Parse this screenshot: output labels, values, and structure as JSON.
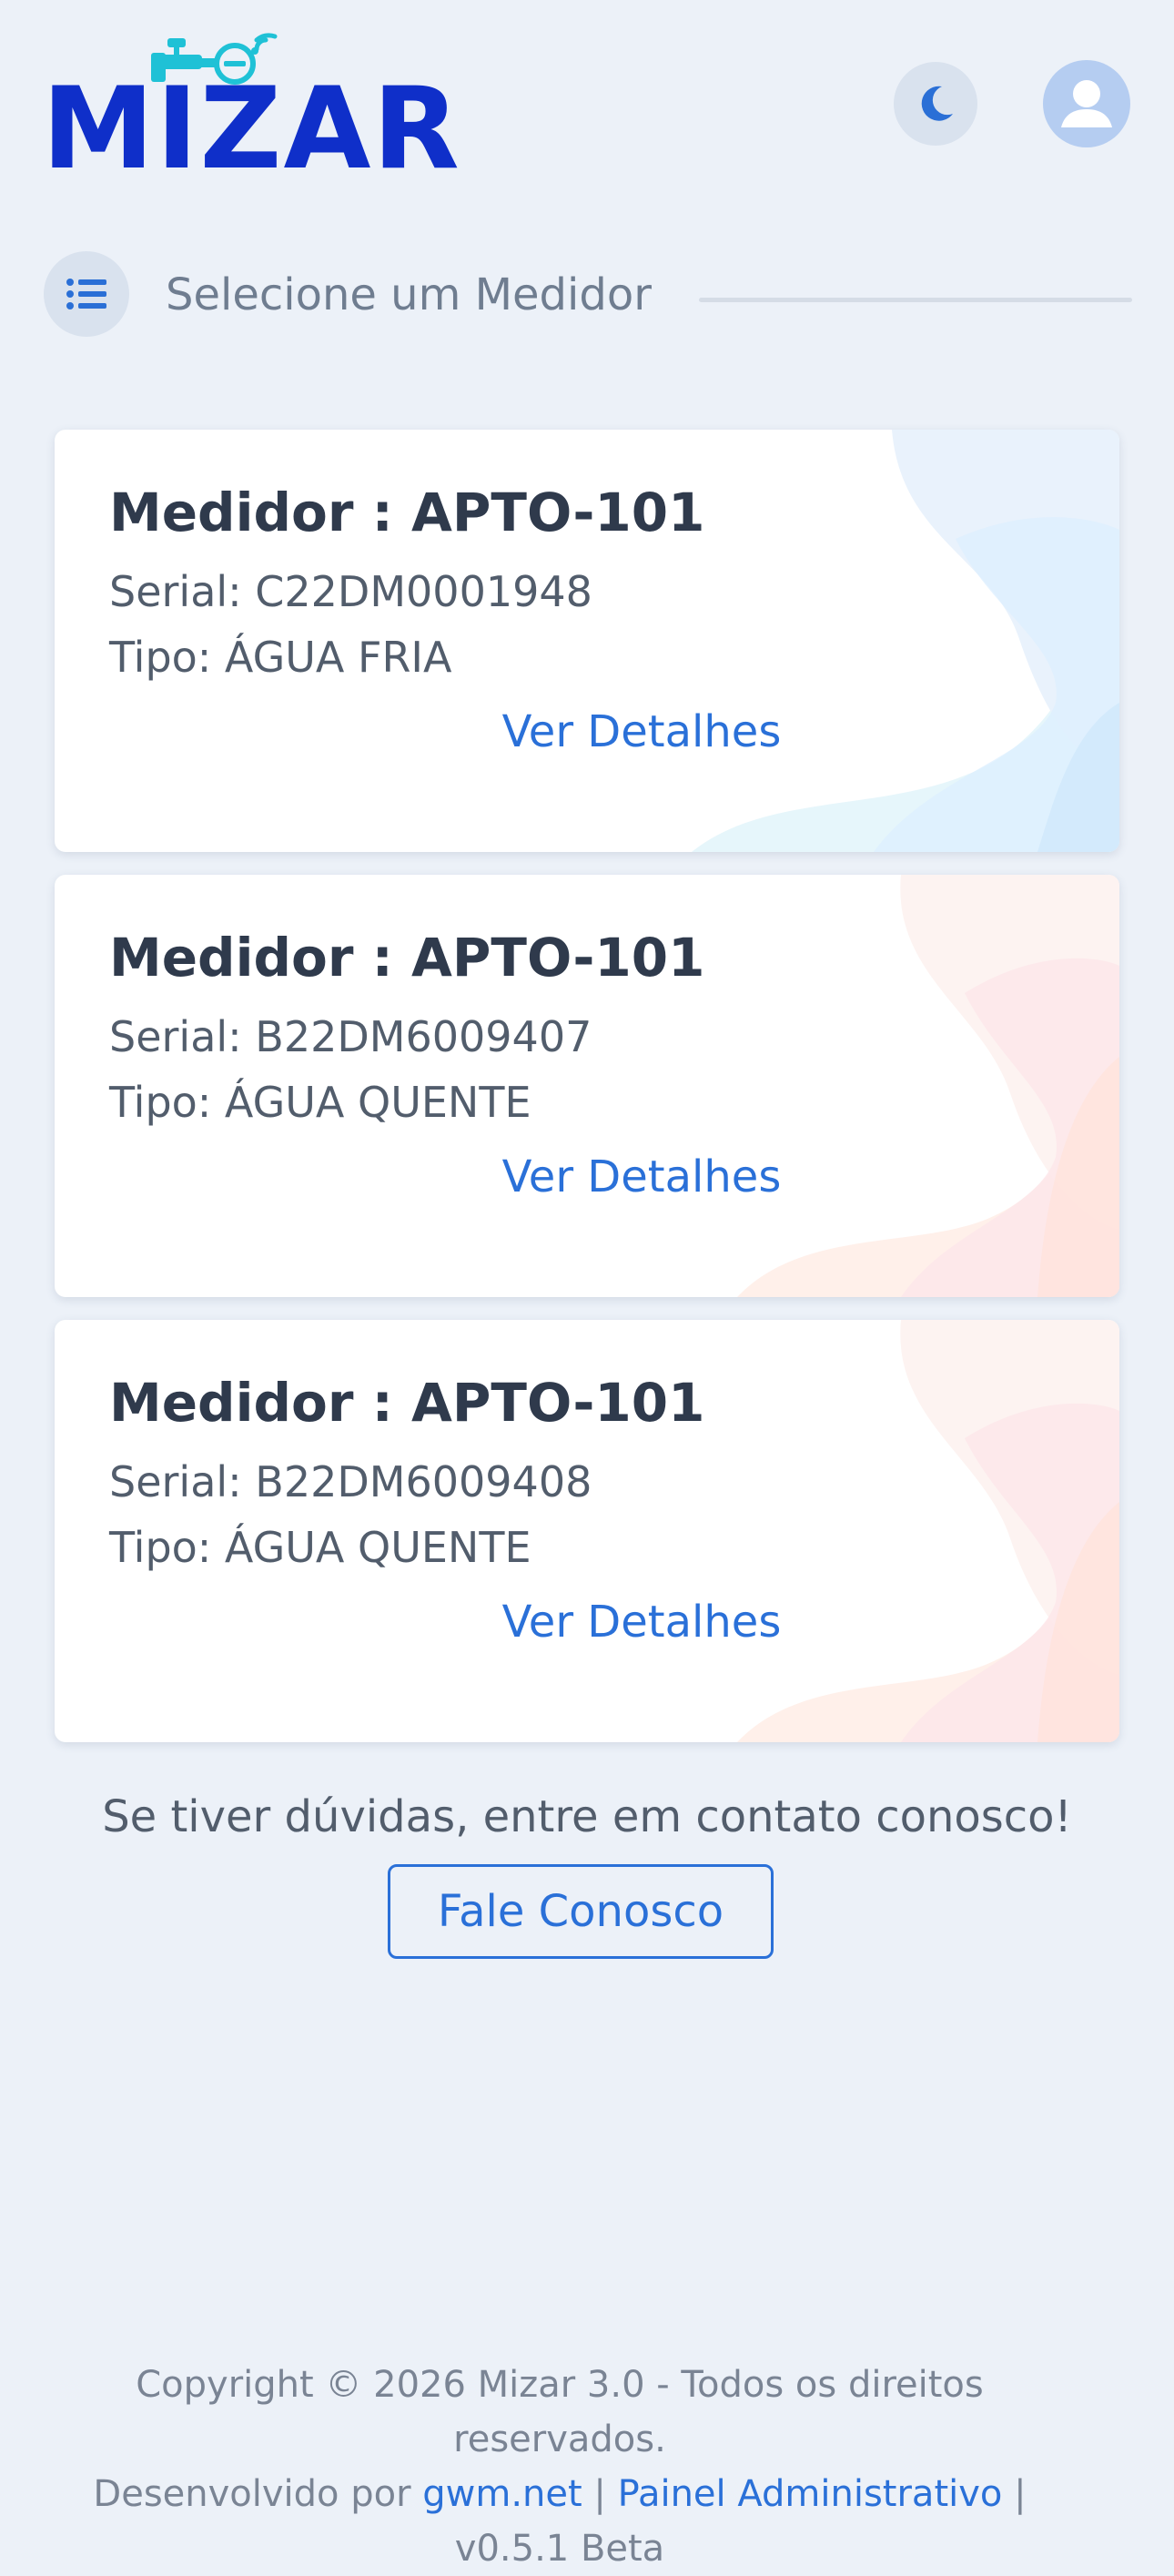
{
  "header": {
    "logo_text": "MIZAR",
    "theme_toggle_icon": "moon-icon",
    "avatar_icon": "user-icon"
  },
  "section": {
    "icon": "list-icon",
    "title": "Selecione um Medidor"
  },
  "meters": [
    {
      "title": "Medidor : APTO-101",
      "serial": "Serial: C22DM0001948",
      "tipo": "Tipo: ÁGUA FRIA",
      "link": "Ver Detalhes",
      "theme": "cold"
    },
    {
      "title": "Medidor : APTO-101",
      "serial": "Serial: B22DM6009407",
      "tipo": "Tipo: ÁGUA QUENTE",
      "link": "Ver Detalhes",
      "theme": "hot"
    },
    {
      "title": "Medidor : APTO-101",
      "serial": "Serial: B22DM6009408",
      "tipo": "Tipo: ÁGUA QUENTE",
      "link": "Ver Detalhes",
      "theme": "hot"
    }
  ],
  "contact": {
    "text": "Se tiver dúvidas, entre em contato conosco!",
    "button": "Fale Conosco"
  },
  "footer": {
    "copyright": "Copyright © 2026 Mizar 3.0 - Todos os direitos reservados.",
    "developed_by": "Desenvolvido por",
    "gwm_link": "gwm.net",
    "separator": "|",
    "admin_link": "Painel Administrativo",
    "version": "v0.5.1 Beta"
  },
  "colors": {
    "brand": "#0f2fc9",
    "accent": "#2a70d8",
    "background": "#ecf1f8",
    "faucet": "#1fc1d6"
  }
}
